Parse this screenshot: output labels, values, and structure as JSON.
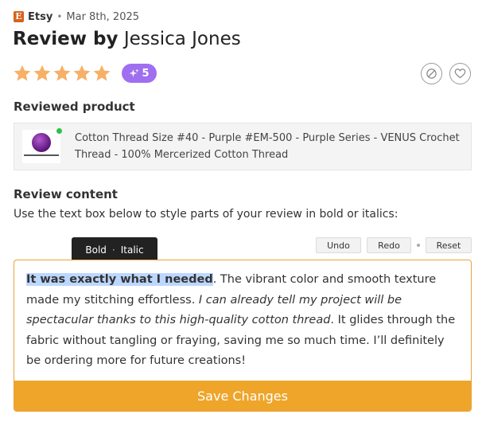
{
  "meta": {
    "brand_initial": "E",
    "brand": "Etsy",
    "separator": "•",
    "date": "Mar 8th, 2025"
  },
  "title": {
    "prefix": "Review by",
    "reviewer": "Jessica Jones"
  },
  "rating": {
    "stars": 5,
    "max": 5,
    "star_color": "#f7b065",
    "ai_badge_value": "5",
    "ai_badge_color": "#a06ef0",
    "ai_badge_icon": "sparkles-icon"
  },
  "actions": {
    "hide_icon": "hide-icon",
    "like_icon": "heart-icon"
  },
  "sections": {
    "product_label": "Reviewed product",
    "content_label": "Review content"
  },
  "product": {
    "name": "Cotton Thread Size #40 - Purple #EM-500 - Purple Series - VENUS Crochet Thread - 100% Mercerized Cotton Thread",
    "status_color": "#2fbf4a"
  },
  "instructions": "Use the text box below to style parts of your review in bold or italics:",
  "toolbar": {
    "bold": "Bold",
    "separator": "·",
    "italic": "Italic",
    "undo": "Undo",
    "redo": "Redo",
    "reset": "Reset"
  },
  "review": {
    "highlighted": "It was exactly what I needed",
    "after_highlight": ". The vibrant color and smooth texture made my stitching effortless. ",
    "italic": "I can already tell my project will be spectacular thanks to this high-quality cotton thread",
    "rest": ". It glides through the fabric without tangling or fraying, saving me so much time. I’ll definitely be ordering more for future creations!"
  },
  "save_label": "Save Changes",
  "colors": {
    "accent": "#eea52a",
    "highlight": "#bcd7ff",
    "etsy_orange": "#d5641c"
  }
}
